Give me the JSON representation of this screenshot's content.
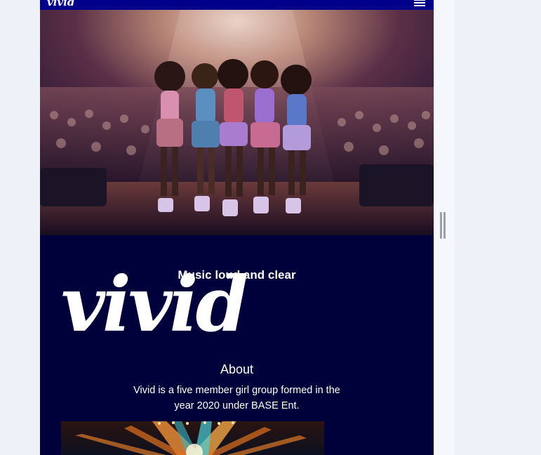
{
  "navbar": {
    "logo_text": "vivid",
    "menu_icon": "hamburger-menu-icon"
  },
  "hero": {
    "image_alt": "girl group performing on stage"
  },
  "main": {
    "tagline": "Music loud and clear",
    "big_logo": "vivid",
    "about_title": "About",
    "about_text": "Vivid is a five member girl group formed in the year 2020 under BASE Ent."
  },
  "colors": {
    "nav_bg": "#00008b",
    "page_bg": "#00003a",
    "text": "#ffffff"
  }
}
